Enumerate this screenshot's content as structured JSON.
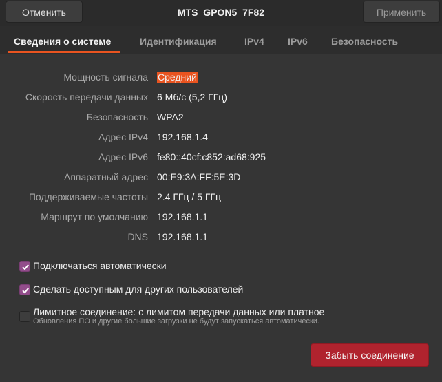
{
  "header": {
    "cancel_label": "Отменить",
    "title": "MTS_GPON5_7F82",
    "apply_label": "Применить"
  },
  "tabs": [
    {
      "label": "Сведения о системе",
      "active": true
    },
    {
      "label": "Идентификация",
      "active": false
    },
    {
      "label": "IPv4",
      "active": false
    },
    {
      "label": "IPv6",
      "active": false
    },
    {
      "label": "Безопасность",
      "active": false
    }
  ],
  "details": [
    {
      "label": "Мощность сигнала",
      "value": "Средний"
    },
    {
      "label": "Скорость передачи данных",
      "value": "6 Мб/с (5,2 ГГц)"
    },
    {
      "label": "Безопасность",
      "value": "WPA2"
    },
    {
      "label": "Адрес IPv4",
      "value": "192.168.1.4"
    },
    {
      "label": "Адрес IPv6",
      "value": "fe80::40cf:c852:ad68:925"
    },
    {
      "label": "Аппаратный адрес",
      "value": "00:E9:3A:FF:5E:3D"
    },
    {
      "label": "Поддерживаемые частоты",
      "value": "2.4 ГГц / 5 ГГц"
    },
    {
      "label": "Маршрут по умолчанию",
      "value": "192.168.1.1"
    },
    {
      "label": "DNS",
      "value": "192.168.1.1"
    }
  ],
  "options": [
    {
      "label": "Подключаться автоматически",
      "checked": true
    },
    {
      "label": "Сделать доступным для других пользователей",
      "checked": true
    },
    {
      "label": "Лимитное соединение: с лимитом передачи данных или платное",
      "checked": false,
      "hint": "Обновления ПО и другие большие загрузки не будут запускаться автоматически."
    }
  ],
  "forget_label": "Забыть соединение",
  "colors": {
    "accent": "#e95420",
    "checkbox": "#924d8b",
    "destructive": "#b0232e"
  }
}
